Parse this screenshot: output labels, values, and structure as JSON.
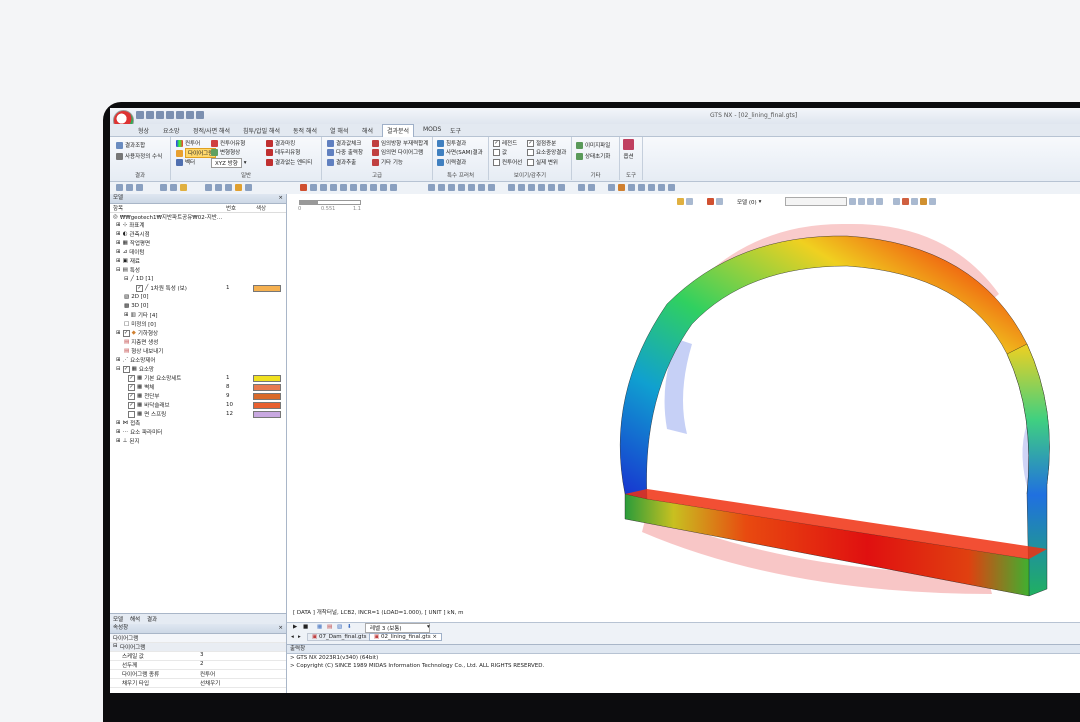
{
  "window": {
    "title": "GTS NX - [02_lining_final.gts]"
  },
  "menu": [
    "형상",
    "요소망",
    "정적/사면 해석",
    "침투/압밀 해석",
    "동적 해석",
    "열 해석",
    "해석",
    "결과분석",
    "MODS",
    "도구"
  ],
  "menu_active": "결과분석",
  "ribbon": {
    "result": {
      "caption": "결과",
      "items": [
        "결과조합",
        "사용자정의 수식"
      ]
    },
    "general": {
      "caption": "일반",
      "items": [
        "컨투어",
        "다이어그램",
        "벡터",
        "XYZ 방향",
        "컨투어유형",
        "변형형상",
        "결과마킹",
        "결과없는 엔티티",
        "결과테이블",
        "테두리유형"
      ]
    },
    "advanced": {
      "caption": "고급",
      "items": [
        "결과값체크",
        "다중 출력창",
        "결과추출",
        "임의방향 부재력합계",
        "임의면 다이어그램",
        "기타 기능"
      ]
    },
    "special": {
      "caption": "특수 프러처",
      "items": [
        "침투결과",
        "사면(SAM)결과",
        "이력결과"
      ]
    },
    "display": {
      "caption": "보이기/감추기",
      "items": [
        "레전드",
        "값",
        "컨투어선",
        "절점증분",
        "요소중앙결과",
        "실제 변위"
      ]
    },
    "misc": {
      "caption": "기타",
      "items": [
        "이미지파일",
        "상태초기화"
      ]
    },
    "tools": {
      "caption": "도구",
      "items": [
        "옵션"
      ]
    }
  },
  "model_panel": {
    "title": "모델",
    "columns": [
      "항목",
      "번호",
      "색상"
    ],
    "items": [
      {
        "label": "₩₩geotech1₩지반파트공유₩02-지반..."
      },
      {
        "label": "좌표계"
      },
      {
        "label": "관측시점"
      },
      {
        "label": "작업평면"
      },
      {
        "label": "데이텀"
      },
      {
        "label": "재료"
      },
      {
        "label": "특성"
      },
      {
        "label": "1D [1]"
      },
      {
        "label": "1차원 특성 (보)",
        "num": "1",
        "color": "#f5b050"
      },
      {
        "label": "2D [0]"
      },
      {
        "label": "3D [0]"
      },
      {
        "label": "기타 [4]"
      },
      {
        "label": "미정의 [0]"
      },
      {
        "label": "기하형상"
      },
      {
        "label": "지층면 생성"
      },
      {
        "label": "형상 내보내기"
      },
      {
        "label": "요소망제어"
      },
      {
        "label": "요소망"
      },
      {
        "label": "기본 요소망세트",
        "num": "1",
        "color": "#f0e020"
      },
      {
        "label": "벽체",
        "num": "8",
        "color": "#e87a50"
      },
      {
        "label": "천단부",
        "num": "9",
        "color": "#d86a2a"
      },
      {
        "label": "바닥슬래브",
        "num": "10",
        "color": "#e86030"
      },
      {
        "label": "면 스프링",
        "num": "12",
        "color": "#c8a8e0"
      },
      {
        "label": "접촉"
      },
      {
        "label": "요소 파라미터"
      },
      {
        "label": "된지"
      }
    ]
  },
  "left_tabs": [
    "모델",
    "해석",
    "결과"
  ],
  "properties": {
    "title": "속성창",
    "section": "다이어그램",
    "group": "다이어그램",
    "rows": [
      {
        "k": "스케일 값",
        "v": "3"
      },
      {
        "k": "선두께",
        "v": "2"
      },
      {
        "k": "다이어그램 종류",
        "v": "컨투어"
      },
      {
        "k": "채우기 타입",
        "v": "선채우기"
      }
    ]
  },
  "viewport": {
    "data_line": "[ DATA ] 개착터널, LCB2, INCR=1 (LOAD=1.000), [ UNIT ] kN, m",
    "legend_label": "모델 (0)",
    "level": "레벨 3 (보통)",
    "scale_ticks": [
      "0",
      "0.551",
      "1.1"
    ]
  },
  "doc_tabs": [
    "07_Dam_final.gts",
    "02_lining_final.gts"
  ],
  "output": {
    "title": "출력창",
    "lines": [
      "> GTS NX 2023R1(v340) (64bit)",
      "> Copyright (C) SINCE 1989 MIDAS Information Technology Co., Ltd. ALL RIGHTS RESERVED."
    ]
  },
  "colors": {
    "accent": "#ffd86b",
    "panel_header": "#cdd8e6"
  }
}
